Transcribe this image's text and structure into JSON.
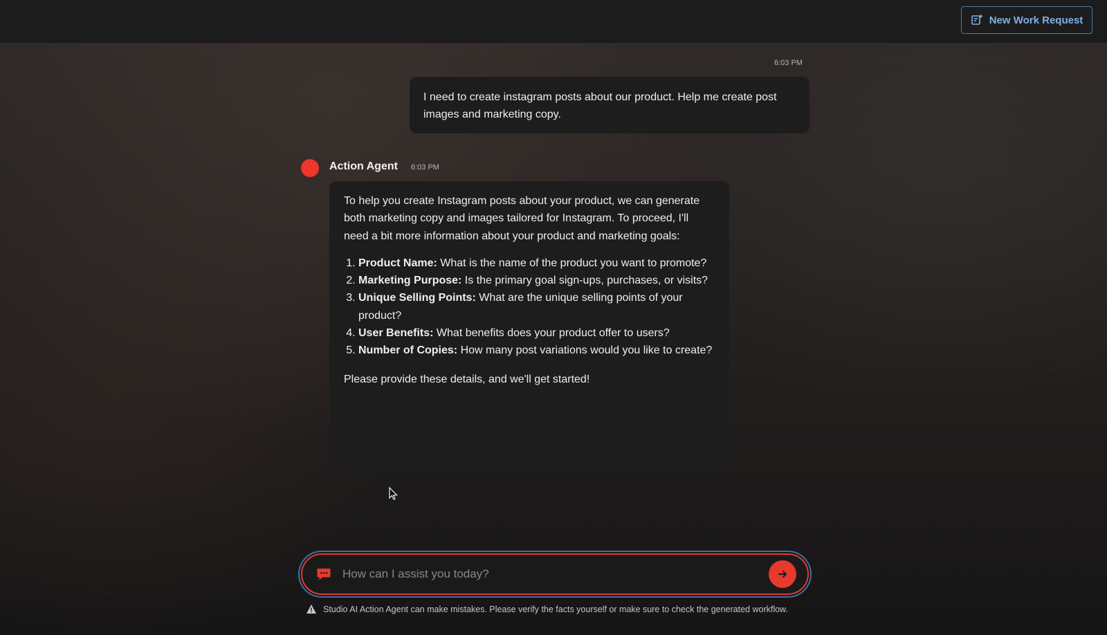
{
  "header": {
    "new_work_request_label": "New Work Request",
    "new_work_request_icon": "note-plus-icon",
    "accent_color": "#7fb0e3"
  },
  "conversation": {
    "user_message": {
      "time": "6:03 PM",
      "text": "I need to create instagram posts about our product. Help me create post images and marketing copy."
    },
    "agent_message": {
      "name": "Action Agent",
      "time": "6:03 PM",
      "avatar_color": "#f0352a",
      "intro": "To help you create Instagram posts about your product, we can generate both marketing copy and images tailored for Instagram. To proceed, I'll need a bit more information about your product and marketing goals:",
      "items": [
        {
          "label": "Product Name:",
          "text": " What is the name of the product you want to promote?"
        },
        {
          "label": "Marketing Purpose:",
          "text": " Is the primary goal sign-ups, purchases, or visits?"
        },
        {
          "label": "Unique Selling Points:",
          "text": " What are the unique selling points of your product?"
        },
        {
          "label": "User Benefits:",
          "text": " What benefits does your product offer to users?"
        },
        {
          "label": "Number of Copies:",
          "text": " How many post variations would you like to create?"
        }
      ],
      "closing": "Please provide these details, and we'll get started!"
    }
  },
  "composer": {
    "placeholder": "How can I assist you today?",
    "value": "",
    "chat_icon": "chat-bubble-icon",
    "send_icon": "arrow-right-icon",
    "accent_color": "#e8392c"
  },
  "footer": {
    "warning_icon": "warning-triangle-icon",
    "disclaimer": "Studio AI Action Agent can make mistakes. Please verify the facts yourself or make sure to check the generated workflow."
  }
}
